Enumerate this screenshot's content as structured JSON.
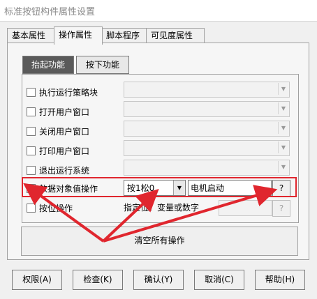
{
  "window": {
    "title": "标准按钮构件属性设置"
  },
  "tabs": [
    {
      "label": "基本属性",
      "active": false
    },
    {
      "label": "操作属性",
      "active": true
    },
    {
      "label": "脚本程序",
      "active": false
    },
    {
      "label": "可见度属性",
      "active": false
    }
  ],
  "subtabs": [
    {
      "label": "抬起功能",
      "selected": true
    },
    {
      "label": "按下功能",
      "selected": false
    }
  ],
  "actions": [
    {
      "label": "执行运行策略块",
      "checked": false
    },
    {
      "label": "打开用户窗口",
      "checked": false
    },
    {
      "label": "关闭用户窗口",
      "checked": false
    },
    {
      "label": "打印用户窗口",
      "checked": false
    },
    {
      "label": "退出运行系统",
      "checked": false
    }
  ],
  "data_op": {
    "label": "数据对象值操作",
    "checked": true,
    "check_mark": "✔",
    "mode_value": "按1松0",
    "object_value": "电机启动",
    "picker_label": "?"
  },
  "bit_op": {
    "label": "按位操作",
    "checked": false,
    "hint": "指定位：变量或数字",
    "picker_label": "?"
  },
  "clear_button": "清空所有操作",
  "footer_buttons": [
    {
      "label": "权限(A)"
    },
    {
      "label": "检查(K)"
    },
    {
      "label": "确认(Y)"
    },
    {
      "label": "取消(C)"
    },
    {
      "label": "帮助(H)"
    }
  ],
  "icons": {
    "dropdown": "chevron-down-icon",
    "annotation": "red-arrow"
  },
  "colors": {
    "annotation": "#e0262e",
    "selected_subtab": "#5a5a5a"
  }
}
